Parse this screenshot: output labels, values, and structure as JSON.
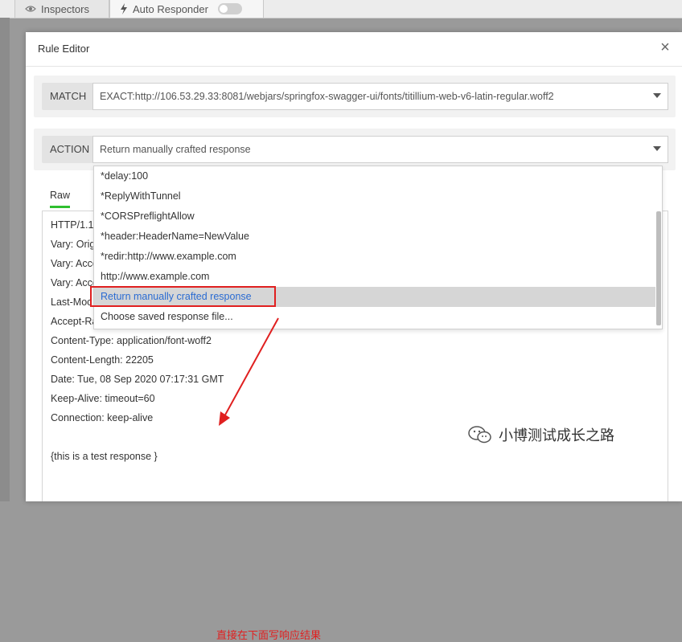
{
  "background": {
    "tabs": [
      {
        "label": "Inspectors",
        "icon": "eye-icon"
      },
      {
        "label": "Auto Responder",
        "icon": "bolt-icon"
      }
    ]
  },
  "modal": {
    "title": "Rule Editor",
    "close_glyph": "×",
    "match": {
      "label": "MATCH",
      "value": "EXACT:http://106.53.29.33:8081/webjars/springfox-swagger-ui/fonts/titillium-web-v6-latin-regular.woff2"
    },
    "action": {
      "label": "ACTION",
      "value": "Return manually crafted response",
      "options": [
        "*delay:100",
        "*ReplyWithTunnel",
        "*CORSPreflightAllow",
        "*header:HeaderName=NewValue",
        "*redir:http://www.example.com",
        "http://www.example.com",
        "Return manually crafted response",
        "Choose saved response file..."
      ],
      "selected_index": 6
    },
    "raw_tab": "Raw",
    "response_lines": [
      "HTTP/1.1",
      "Vary: Orig",
      "Vary: Acce",
      "Vary: Acce",
      "Last-Moc",
      "Accept-Ra",
      "Content-Type: application/font-woff2",
      "Content-Length: 22205",
      "Date: Tue, 08 Sep 2020 07:17:31 GMT",
      "Keep-Alive: timeout=60",
      "Connection: keep-alive",
      "",
      "{this is a test response }"
    ]
  },
  "annotation": {
    "text": "直接在下面写响应结果",
    "color": "#e02020"
  },
  "watermark": {
    "text": "小博测试成长之路"
  },
  "colors": {
    "accent_green": "#2fbf2f",
    "selected_text": "#2a6bd2",
    "highlight": "#e02020"
  }
}
